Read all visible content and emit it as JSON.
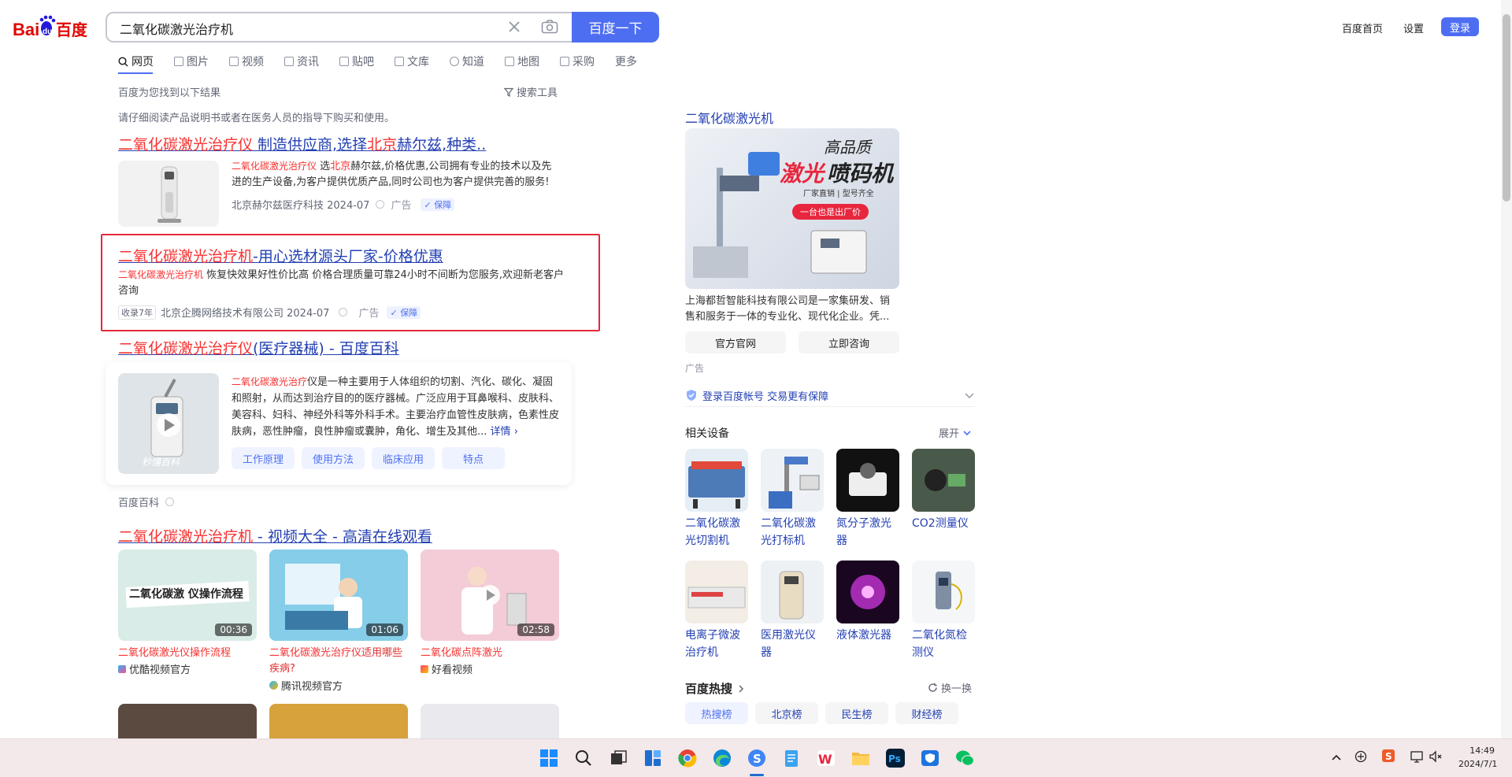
{
  "header": {
    "logo_text": "Bai du 百度",
    "search_value": "二氧化碳激光治疗机",
    "search_button": "百度一下",
    "nav_home": "百度首页",
    "nav_settings": "设置",
    "nav_login": "登录"
  },
  "tabs": [
    {
      "label": "网页"
    },
    {
      "label": "图片"
    },
    {
      "label": "视频"
    },
    {
      "label": "资讯"
    },
    {
      "label": "贴吧"
    },
    {
      "label": "文库"
    },
    {
      "label": "知道"
    },
    {
      "label": "地图"
    },
    {
      "label": "采购"
    },
    {
      "label": "更多"
    }
  ],
  "info": {
    "found": "百度为您找到以下结果",
    "tools": "搜索工具",
    "notice": "请仔细阅读产品说明书或者在医务人员的指导下购买和使用。"
  },
  "results": {
    "r1": {
      "title_red": "二氧化碳激光治疗仪",
      "title_rest1": " 制造供应商,选择",
      "title_red2": "北京",
      "title_rest2": "赫尔兹,种类..",
      "desc_red": "二氧化碳激光治疗仪",
      "desc_mid": " 选",
      "desc_red2": "北京",
      "desc_rest": "赫尔兹,价格优惠,公司拥有专业的技术以及先进的生产设备,为客户提供优质产品,同时公司也为客户提供完善的服务!",
      "source": "北京赫尔兹医疗科技 2024-07",
      "ad": "广告",
      "guarantee": "保障"
    },
    "r2": {
      "title_red": "二氧化碳激光治疗机",
      "title_rest": "-用心选材源头厂家-价格优惠",
      "desc_red": "二氧化碳激光治疗机",
      "desc_rest": " 恢复快效果好性价比高 价格合理质量可靠24小时不间断为您服务,欢迎新老客户咨询",
      "tag": "收录7年",
      "source": "北京企腾网络技术有限公司 2024-07",
      "ad": "广告",
      "guarantee": "保障"
    },
    "r3": {
      "title_red": "二氧化碳激光治疗仪",
      "title_rest": "(医疗器械) - 百度百科",
      "desc_red": "二氧化碳激光治疗",
      "desc_rest": "仪是一种主要用于人体组织的切割、汽化、碳化、凝固和照射，从而达到治疗目的的医疗器械。广泛应用于耳鼻喉科、皮肤科、美容科、妇科、神经外科等外科手术。主要治疗血管性皮肤病，色素性皮肤病，恶性肿瘤，良性肿瘤或囊肿，角化、增生及其他...",
      "more": "详情",
      "watermark": "秒懂百科",
      "chips": [
        "工作原理",
        "使用方法",
        "临床应用",
        "特点"
      ],
      "source": "百度百科"
    },
    "r4": {
      "title_red": "二氧化碳激光治疗机",
      "title_rest": " - 视频大全 - 高清在线观看",
      "videos": [
        {
          "overlay": "二氧化碳激 仪操作流程",
          "duration": "00:36",
          "title_red": "二氧化碳激光",
          "title_rest": "仪操作流程",
          "source": "优酷视频官方"
        },
        {
          "overlay": "",
          "duration": "01:06",
          "title_red": "二氧化碳激光治疗仪",
          "title_rest": "适用哪些疾病?",
          "source": "腾讯视频官方"
        },
        {
          "overlay": "",
          "duration": "02:58",
          "title_red": "二氧化碳",
          "title_rest": "点阵激光",
          "source": "好看视频"
        }
      ]
    }
  },
  "sidebar": {
    "ad_title": "二氧化碳激光机",
    "ad_img_text1": "高品质",
    "ad_img_text2": "激光",
    "ad_img_text3": "喷码机",
    "ad_img_sub": "厂家直销 | 型号齐全",
    "ad_img_badge": "一台也是出厂价",
    "ad_desc": "上海都哲智能科技有限公司是一家集研发、销售和服务于一体的专业化、现代化企业。凭...",
    "btn_official": "官方官网",
    "btn_consult": "立即咨询",
    "ad_label": "广告",
    "login_tip": "登录百度帐号 交易更有保障",
    "related_title": "相关设备",
    "expand": "展开",
    "related": [
      {
        "label": "二氧化碳激光切割机"
      },
      {
        "label": "二氧化碳激光打标机"
      },
      {
        "label": "氮分子激光器"
      },
      {
        "label": "CO2测量仪"
      },
      {
        "label": "电离子微波治疗机"
      },
      {
        "label": "医用激光仪器"
      },
      {
        "label": "液体激光器"
      },
      {
        "label": "二氧化氮检测仪"
      }
    ],
    "hot_title": "百度热搜",
    "refresh": "换一换",
    "hot_tabs": [
      "热搜榜",
      "北京榜",
      "民生榜",
      "财经榜"
    ]
  },
  "taskbar": {
    "time": "14:49",
    "date": "2024/7/1"
  },
  "colors": {
    "brand_blue": "#4e6ef2",
    "link_blue": "#2440b3",
    "highlight_red": "#f73131",
    "annotation_red": "#e8263d"
  }
}
